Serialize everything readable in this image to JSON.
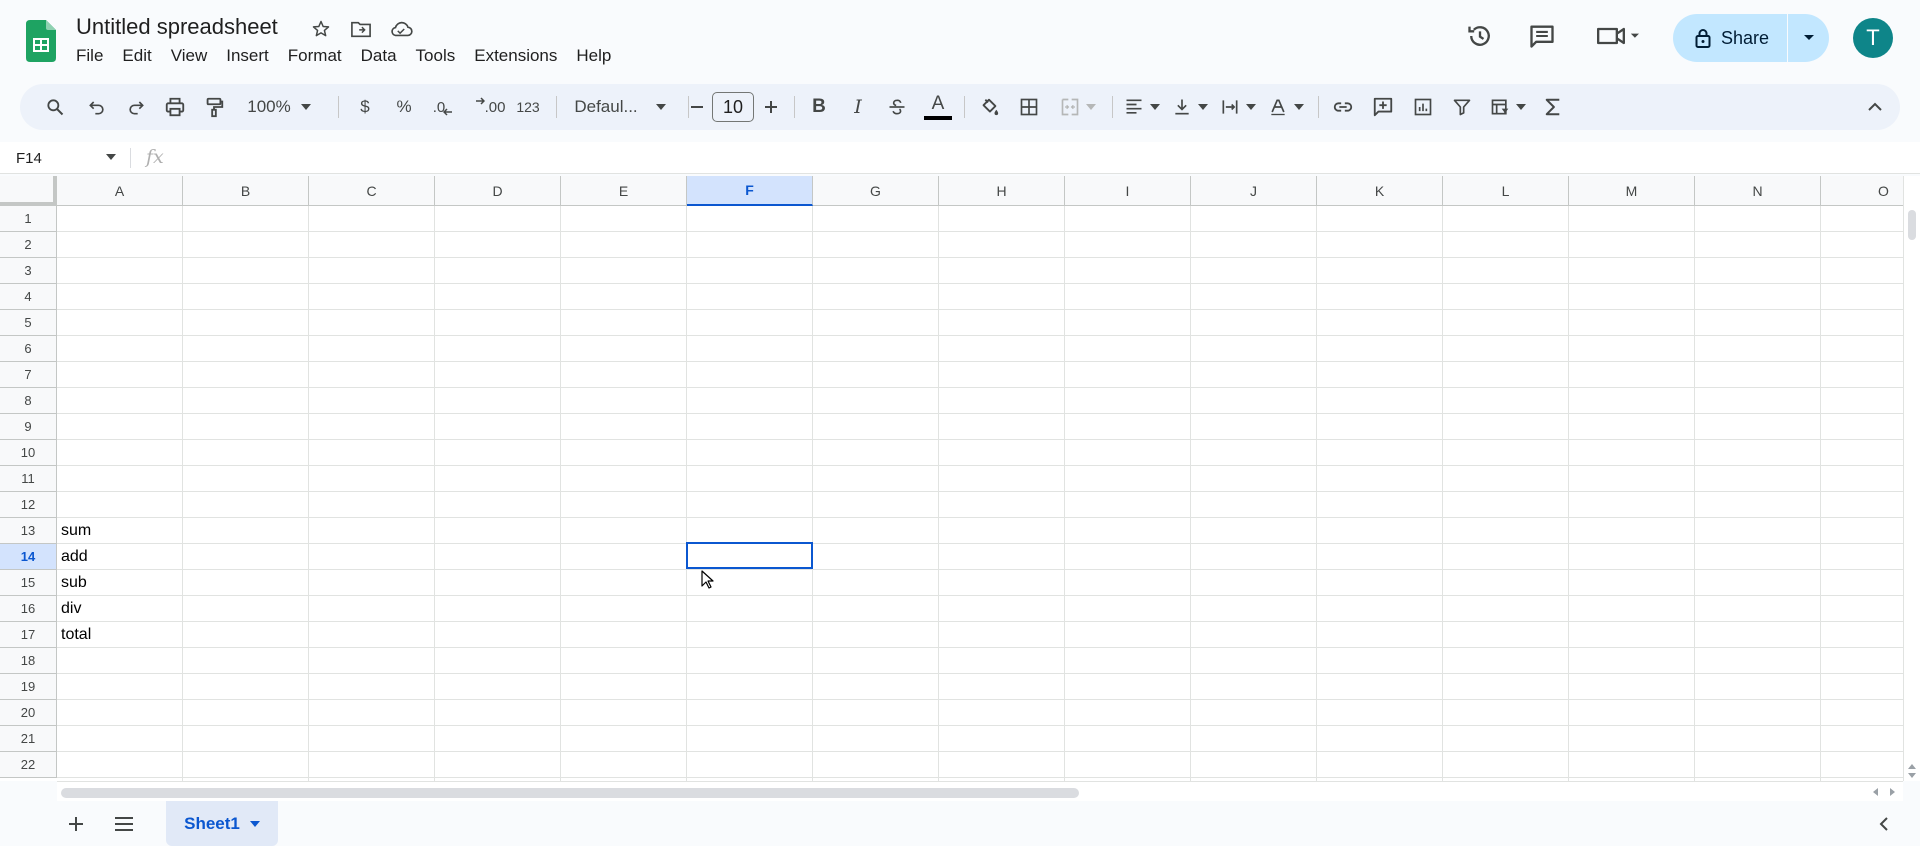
{
  "header": {
    "title": "Untitled spreadsheet",
    "menu": [
      "File",
      "Edit",
      "View",
      "Insert",
      "Format",
      "Data",
      "Tools",
      "Extensions",
      "Help"
    ],
    "share_label": "Share",
    "avatar_initial": "T"
  },
  "toolbar": {
    "zoom": "100%",
    "currency": "$",
    "percent": "%",
    "dec_decrease": ".0",
    "dec_increase": ".00",
    "number_format": "123",
    "font": "Defaul...",
    "font_size": "10",
    "bold": "B",
    "italic": "I",
    "text_color": "A"
  },
  "formula_bar": {
    "name_box": "F14",
    "fx": "fx"
  },
  "grid": {
    "columns": [
      "A",
      "B",
      "C",
      "D",
      "E",
      "F",
      "G",
      "H",
      "I",
      "J",
      "K",
      "L",
      "M",
      "N",
      "O"
    ],
    "rows": [
      "1",
      "2",
      "3",
      "4",
      "5",
      "6",
      "7",
      "8",
      "9",
      "10",
      "11",
      "12",
      "13",
      "14",
      "15",
      "16",
      "17",
      "18",
      "19",
      "20",
      "21",
      "22"
    ],
    "selected_column": "F",
    "selected_row": "14",
    "cells": [
      {
        "ref": "A13",
        "value": "sum"
      },
      {
        "ref": "A14",
        "value": "add"
      },
      {
        "ref": "A15",
        "value": "sub"
      },
      {
        "ref": "A16",
        "value": "div"
      },
      {
        "ref": "A17",
        "value": "total"
      }
    ]
  },
  "bottom": {
    "sheet_tab": "Sheet1"
  },
  "colors": {
    "accent": "#0b57d0",
    "share_bg": "#c2e7ff",
    "avatar_bg": "#0e8589",
    "logo_green": "#1ea362"
  }
}
